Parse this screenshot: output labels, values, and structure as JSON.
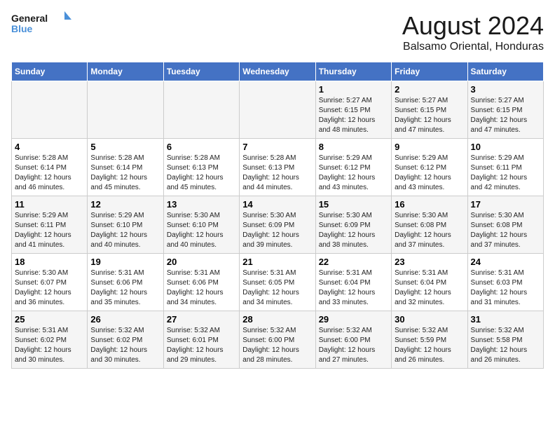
{
  "logo": {
    "line1": "General",
    "line2": "Blue"
  },
  "title": "August 2024",
  "subtitle": "Balsamo Oriental, Honduras",
  "days_of_week": [
    "Sunday",
    "Monday",
    "Tuesday",
    "Wednesday",
    "Thursday",
    "Friday",
    "Saturday"
  ],
  "weeks": [
    [
      {
        "day": "",
        "info": ""
      },
      {
        "day": "",
        "info": ""
      },
      {
        "day": "",
        "info": ""
      },
      {
        "day": "",
        "info": ""
      },
      {
        "day": "1",
        "info": "Sunrise: 5:27 AM\nSunset: 6:15 PM\nDaylight: 12 hours\nand 48 minutes."
      },
      {
        "day": "2",
        "info": "Sunrise: 5:27 AM\nSunset: 6:15 PM\nDaylight: 12 hours\nand 47 minutes."
      },
      {
        "day": "3",
        "info": "Sunrise: 5:27 AM\nSunset: 6:15 PM\nDaylight: 12 hours\nand 47 minutes."
      }
    ],
    [
      {
        "day": "4",
        "info": "Sunrise: 5:28 AM\nSunset: 6:14 PM\nDaylight: 12 hours\nand 46 minutes."
      },
      {
        "day": "5",
        "info": "Sunrise: 5:28 AM\nSunset: 6:14 PM\nDaylight: 12 hours\nand 45 minutes."
      },
      {
        "day": "6",
        "info": "Sunrise: 5:28 AM\nSunset: 6:13 PM\nDaylight: 12 hours\nand 45 minutes."
      },
      {
        "day": "7",
        "info": "Sunrise: 5:28 AM\nSunset: 6:13 PM\nDaylight: 12 hours\nand 44 minutes."
      },
      {
        "day": "8",
        "info": "Sunrise: 5:29 AM\nSunset: 6:12 PM\nDaylight: 12 hours\nand 43 minutes."
      },
      {
        "day": "9",
        "info": "Sunrise: 5:29 AM\nSunset: 6:12 PM\nDaylight: 12 hours\nand 43 minutes."
      },
      {
        "day": "10",
        "info": "Sunrise: 5:29 AM\nSunset: 6:11 PM\nDaylight: 12 hours\nand 42 minutes."
      }
    ],
    [
      {
        "day": "11",
        "info": "Sunrise: 5:29 AM\nSunset: 6:11 PM\nDaylight: 12 hours\nand 41 minutes."
      },
      {
        "day": "12",
        "info": "Sunrise: 5:29 AM\nSunset: 6:10 PM\nDaylight: 12 hours\nand 40 minutes."
      },
      {
        "day": "13",
        "info": "Sunrise: 5:30 AM\nSunset: 6:10 PM\nDaylight: 12 hours\nand 40 minutes."
      },
      {
        "day": "14",
        "info": "Sunrise: 5:30 AM\nSunset: 6:09 PM\nDaylight: 12 hours\nand 39 minutes."
      },
      {
        "day": "15",
        "info": "Sunrise: 5:30 AM\nSunset: 6:09 PM\nDaylight: 12 hours\nand 38 minutes."
      },
      {
        "day": "16",
        "info": "Sunrise: 5:30 AM\nSunset: 6:08 PM\nDaylight: 12 hours\nand 37 minutes."
      },
      {
        "day": "17",
        "info": "Sunrise: 5:30 AM\nSunset: 6:08 PM\nDaylight: 12 hours\nand 37 minutes."
      }
    ],
    [
      {
        "day": "18",
        "info": "Sunrise: 5:30 AM\nSunset: 6:07 PM\nDaylight: 12 hours\nand 36 minutes."
      },
      {
        "day": "19",
        "info": "Sunrise: 5:31 AM\nSunset: 6:06 PM\nDaylight: 12 hours\nand 35 minutes."
      },
      {
        "day": "20",
        "info": "Sunrise: 5:31 AM\nSunset: 6:06 PM\nDaylight: 12 hours\nand 34 minutes."
      },
      {
        "day": "21",
        "info": "Sunrise: 5:31 AM\nSunset: 6:05 PM\nDaylight: 12 hours\nand 34 minutes."
      },
      {
        "day": "22",
        "info": "Sunrise: 5:31 AM\nSunset: 6:04 PM\nDaylight: 12 hours\nand 33 minutes."
      },
      {
        "day": "23",
        "info": "Sunrise: 5:31 AM\nSunset: 6:04 PM\nDaylight: 12 hours\nand 32 minutes."
      },
      {
        "day": "24",
        "info": "Sunrise: 5:31 AM\nSunset: 6:03 PM\nDaylight: 12 hours\nand 31 minutes."
      }
    ],
    [
      {
        "day": "25",
        "info": "Sunrise: 5:31 AM\nSunset: 6:02 PM\nDaylight: 12 hours\nand 30 minutes."
      },
      {
        "day": "26",
        "info": "Sunrise: 5:32 AM\nSunset: 6:02 PM\nDaylight: 12 hours\nand 30 minutes."
      },
      {
        "day": "27",
        "info": "Sunrise: 5:32 AM\nSunset: 6:01 PM\nDaylight: 12 hours\nand 29 minutes."
      },
      {
        "day": "28",
        "info": "Sunrise: 5:32 AM\nSunset: 6:00 PM\nDaylight: 12 hours\nand 28 minutes."
      },
      {
        "day": "29",
        "info": "Sunrise: 5:32 AM\nSunset: 6:00 PM\nDaylight: 12 hours\nand 27 minutes."
      },
      {
        "day": "30",
        "info": "Sunrise: 5:32 AM\nSunset: 5:59 PM\nDaylight: 12 hours\nand 26 minutes."
      },
      {
        "day": "31",
        "info": "Sunrise: 5:32 AM\nSunset: 5:58 PM\nDaylight: 12 hours\nand 26 minutes."
      }
    ]
  ]
}
